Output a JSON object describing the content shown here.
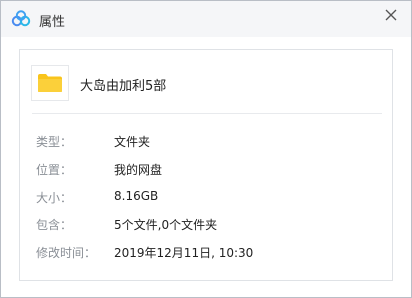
{
  "window": {
    "title": "属性"
  },
  "file": {
    "name": "大岛由加利5部"
  },
  "props": [
    {
      "label": "类型：",
      "value": "文件夹"
    },
    {
      "label": "位置：",
      "value": "我的网盘"
    },
    {
      "label": "大小：",
      "value": "8.16GB"
    },
    {
      "label": "包含：",
      "value": "5个文件,0个文件夹"
    },
    {
      "label": "修改时间：",
      "value": "2019年12月11日, 10:30"
    }
  ],
  "icons": {
    "app": "baidu-netdisk-cloud-icon",
    "folder": "folder-icon",
    "close": "close-icon"
  },
  "colors": {
    "folder": "#f9c41b",
    "app_blue": "#4a8cf0"
  }
}
